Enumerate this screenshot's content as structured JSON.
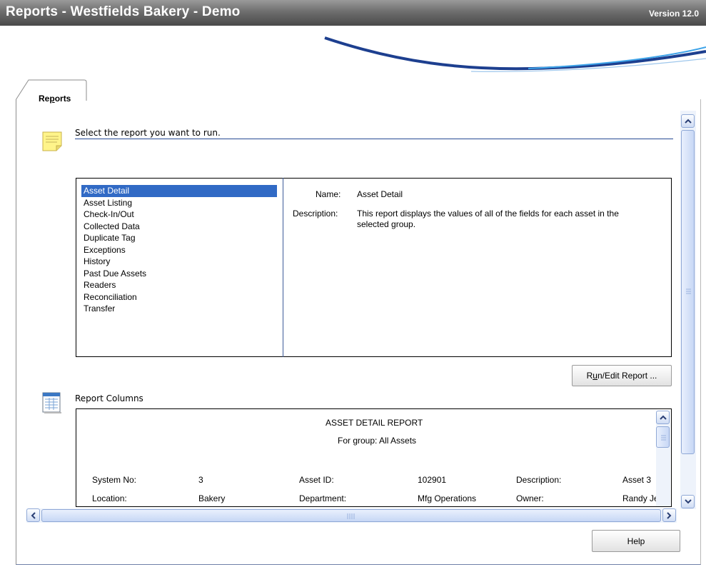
{
  "window": {
    "title": "Reports - Westfields Bakery - Demo",
    "version": "Version 12.0"
  },
  "tabs": [
    {
      "label_pre": "Re",
      "label_ul": "p",
      "label_post": "orts"
    }
  ],
  "instructions": "Select the report you want to run.",
  "reports": {
    "items": [
      "Asset Detail",
      "Asset Listing",
      "Check-In/Out",
      "Collected Data",
      "Duplicate Tag",
      "Exceptions",
      "History",
      "Past Due Assets",
      "Readers",
      "Reconciliation",
      "Transfer"
    ],
    "selected_index": 0
  },
  "details": {
    "name_label": "Name:",
    "name_value": "Asset Detail",
    "description_label": "Description:",
    "description_value": "This report displays the values of all of the fields for each asset in the selected group."
  },
  "buttons": {
    "run_pre": "R",
    "run_ul": "u",
    "run_post": "n/Edit Report ...",
    "help": "Help"
  },
  "report_columns": {
    "label": "Report Columns",
    "preview": {
      "title": "ASSET DETAIL REPORT",
      "subtitle": "For group: All Assets",
      "row1": {
        "l1": "System No:",
        "v1": "3",
        "l2": "Asset ID:",
        "v2": "102901",
        "l3": "Description:",
        "v3": "Asset 3"
      },
      "row2": {
        "l1": "Location:",
        "v1": "Bakery",
        "l2": "Department:",
        "v2": "Mfg Operations",
        "l3": "Owner:",
        "v3": "Randy Je"
      }
    }
  },
  "colors": {
    "selection": "#316ac5",
    "accent": "#274a94",
    "swoosh_light": "#3da3e8",
    "swoosh_dark": "#1d3f8f"
  }
}
